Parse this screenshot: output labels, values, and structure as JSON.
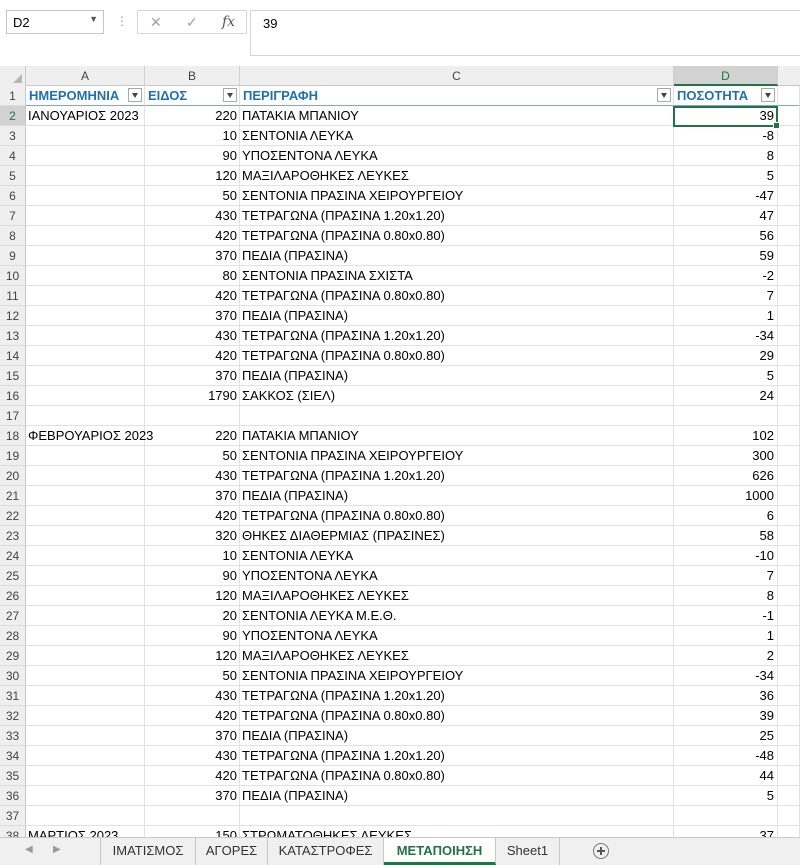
{
  "formula_bar": {
    "name_box": "D2",
    "cancel_icon": "✕",
    "enter_icon": "✓",
    "function_icon": "fx",
    "value": "39"
  },
  "columns": [
    "A",
    "B",
    "C",
    "D"
  ],
  "header": {
    "a": "ΗΜΕΡΟΜΗΝΙΑ",
    "b": "ΕΙΔΟΣ",
    "c": "ΠΕΡΙΓΡΑΦΗ",
    "d": "ΠΟΣΟΤΗΤΑ"
  },
  "rows": [
    {
      "n": "2",
      "a": "ΙΑΝΟΥΑΡΙΟΣ 2023",
      "b": "220",
      "c": "ΠΑΤΑΚΙΑ ΜΠΑΝΙΟΥ",
      "d": "39"
    },
    {
      "n": "3",
      "a": "",
      "b": "10",
      "c": "ΣΕΝΤΟΝΙΑ ΛΕΥΚΑ",
      "d": "-8"
    },
    {
      "n": "4",
      "a": "",
      "b": "90",
      "c": "ΥΠΟΣΕΝΤΟΝΑ ΛΕΥΚΑ",
      "d": "8"
    },
    {
      "n": "5",
      "a": "",
      "b": "120",
      "c": "ΜΑΞΙΛΑΡΟΘΗΚΕΣ ΛΕΥΚΕΣ",
      "d": "5"
    },
    {
      "n": "6",
      "a": "",
      "b": "50",
      "c": "ΣΕΝΤΟΝΙΑ ΠΡΑΣΙΝΑ ΧΕΙΡΟΥΡΓΕΙΟΥ",
      "d": "-47"
    },
    {
      "n": "7",
      "a": "",
      "b": "430",
      "c": "ΤΕΤΡΑΓΩΝΑ (ΠΡΑΣΙΝΑ 1.20x1.20)",
      "d": "47"
    },
    {
      "n": "8",
      "a": "",
      "b": "420",
      "c": "ΤΕΤΡΑΓΩΝΑ (ΠΡΑΣΙΝΑ 0.80x0.80)",
      "d": "56"
    },
    {
      "n": "9",
      "a": "",
      "b": "370",
      "c": "ΠΕΔΙΑ (ΠΡΑΣΙΝΑ)",
      "d": "59"
    },
    {
      "n": "10",
      "a": "",
      "b": "80",
      "c": "ΣΕΝΤΟΝΙΑ ΠΡΑΣΙΝΑ ΣΧΙΣΤΑ",
      "d": "-2"
    },
    {
      "n": "11",
      "a": "",
      "b": "420",
      "c": "ΤΕΤΡΑΓΩΝΑ (ΠΡΑΣΙΝΑ 0.80x0.80)",
      "d": "7"
    },
    {
      "n": "12",
      "a": "",
      "b": "370",
      "c": "ΠΕΔΙΑ (ΠΡΑΣΙΝΑ)",
      "d": "1"
    },
    {
      "n": "13",
      "a": "",
      "b": "430",
      "c": "ΤΕΤΡΑΓΩΝΑ (ΠΡΑΣΙΝΑ 1.20x1.20)",
      "d": "-34"
    },
    {
      "n": "14",
      "a": "",
      "b": "420",
      "c": "ΤΕΤΡΑΓΩΝΑ (ΠΡΑΣΙΝΑ 0.80x0.80)",
      "d": "29"
    },
    {
      "n": "15",
      "a": "",
      "b": "370",
      "c": "ΠΕΔΙΑ (ΠΡΑΣΙΝΑ)",
      "d": "5"
    },
    {
      "n": "16",
      "a": "",
      "b": "1790",
      "c": "ΣΑΚΚΟΣ (ΣΙΕΛ)",
      "d": "24"
    },
    {
      "n": "17",
      "a": "",
      "b": "",
      "c": "",
      "d": ""
    },
    {
      "n": "18",
      "a": "ΦΕΒΡΟΥΑΡΙΟΣ 2023",
      "b": "220",
      "c": "ΠΑΤΑΚΙΑ ΜΠΑΝΙΟΥ",
      "d": "102"
    },
    {
      "n": "19",
      "a": "",
      "b": "50",
      "c": "ΣΕΝΤΟΝΙΑ ΠΡΑΣΙΝΑ ΧΕΙΡΟΥΡΓΕΙΟΥ",
      "d": "300"
    },
    {
      "n": "20",
      "a": "",
      "b": "430",
      "c": "ΤΕΤΡΑΓΩΝΑ (ΠΡΑΣΙΝΑ 1.20x1.20)",
      "d": "626"
    },
    {
      "n": "21",
      "a": "",
      "b": "370",
      "c": "ΠΕΔΙΑ (ΠΡΑΣΙΝΑ)",
      "d": "1000"
    },
    {
      "n": "22",
      "a": "",
      "b": "420",
      "c": "ΤΕΤΡΑΓΩΝΑ (ΠΡΑΣΙΝΑ 0.80x0.80)",
      "d": "6"
    },
    {
      "n": "23",
      "a": "",
      "b": "320",
      "c": "ΘΗΚΕΣ ΔΙΑΘΕΡΜΙΑΣ (ΠΡΑΣΙΝΕΣ)",
      "d": "58"
    },
    {
      "n": "24",
      "a": "",
      "b": "10",
      "c": "ΣΕΝΤΟΝΙΑ ΛΕΥΚΑ",
      "d": "-10"
    },
    {
      "n": "25",
      "a": "",
      "b": "90",
      "c": "ΥΠΟΣΕΝΤΟΝΑ ΛΕΥΚΑ",
      "d": "7"
    },
    {
      "n": "26",
      "a": "",
      "b": "120",
      "c": "ΜΑΞΙΛΑΡΟΘΗΚΕΣ ΛΕΥΚΕΣ",
      "d": "8"
    },
    {
      "n": "27",
      "a": "",
      "b": "20",
      "c": "ΣΕΝΤΟΝΙΑ ΛΕΥΚΑ Μ.Ε.Θ.",
      "d": "-1"
    },
    {
      "n": "28",
      "a": "",
      "b": "90",
      "c": "ΥΠΟΣΕΝΤΟΝΑ ΛΕΥΚΑ",
      "d": "1"
    },
    {
      "n": "29",
      "a": "",
      "b": "120",
      "c": "ΜΑΞΙΛΑΡΟΘΗΚΕΣ ΛΕΥΚΕΣ",
      "d": "2"
    },
    {
      "n": "30",
      "a": "",
      "b": "50",
      "c": "ΣΕΝΤΟΝΙΑ ΠΡΑΣΙΝΑ ΧΕΙΡΟΥΡΓΕΙΟΥ",
      "d": "-34"
    },
    {
      "n": "31",
      "a": "",
      "b": "430",
      "c": "ΤΕΤΡΑΓΩΝΑ (ΠΡΑΣΙΝΑ 1.20x1.20)",
      "d": "36"
    },
    {
      "n": "32",
      "a": "",
      "b": "420",
      "c": "ΤΕΤΡΑΓΩΝΑ (ΠΡΑΣΙΝΑ 0.80x0.80)",
      "d": "39"
    },
    {
      "n": "33",
      "a": "",
      "b": "370",
      "c": "ΠΕΔΙΑ (ΠΡΑΣΙΝΑ)",
      "d": "25"
    },
    {
      "n": "34",
      "a": "",
      "b": "430",
      "c": "ΤΕΤΡΑΓΩΝΑ (ΠΡΑΣΙΝΑ 1.20x1.20)",
      "d": "-48"
    },
    {
      "n": "35",
      "a": "",
      "b": "420",
      "c": "ΤΕΤΡΑΓΩΝΑ (ΠΡΑΣΙΝΑ 0.80x0.80)",
      "d": "44"
    },
    {
      "n": "36",
      "a": "",
      "b": "370",
      "c": "ΠΕΔΙΑ (ΠΡΑΣΙΝΑ)",
      "d": "5"
    },
    {
      "n": "37",
      "a": "",
      "b": "",
      "c": "",
      "d": ""
    },
    {
      "n": "38",
      "a": "ΜΑΡΤΙΟΣ 2023",
      "b": "150",
      "c": "ΣΤΡΩΜΑΤΟΘΗΚΕΣ ΛΕΥΚΕΣ",
      "d": "37"
    }
  ],
  "sheet_tabs": [
    "ΙΜΑΤΙΣΜΟΣ",
    "ΑΓΟΡΕΣ",
    "ΚΑΤΑΣΤΡΟΦΕΣ",
    "ΜΕΤΑΠΟΙΗΣΗ",
    "Sheet1"
  ],
  "active_tab": "ΜΕΤΑΠΟΙΗΣΗ",
  "colors": {
    "accent": "#217346",
    "header_text": "#1f6fb2"
  }
}
